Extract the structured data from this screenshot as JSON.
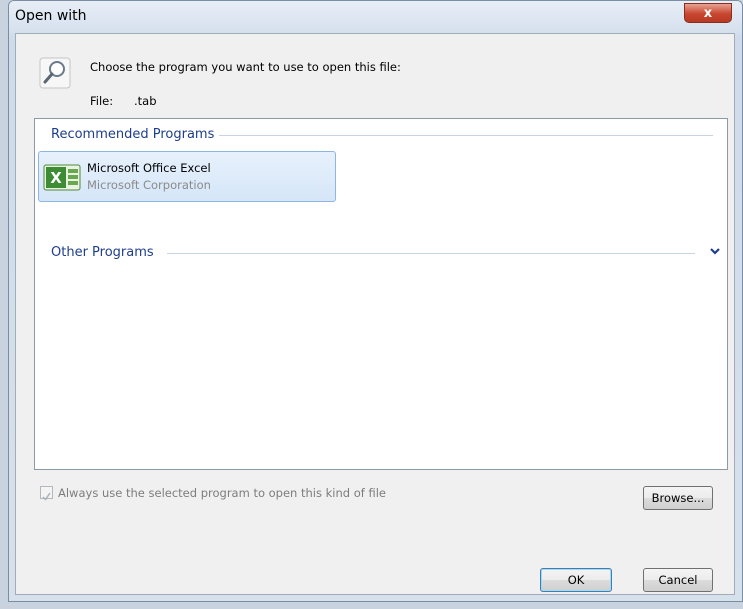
{
  "window": {
    "title": "Open with",
    "close_glyph": "x"
  },
  "header": {
    "prompt": "Choose the program you want to use to open this file:",
    "file_label": "File:",
    "file_name": ".tab",
    "icon": "magnifier-icon"
  },
  "groups": {
    "recommended": "Recommended Programs",
    "other": "Other Programs"
  },
  "programs": [
    {
      "name": "Microsoft Office Excel",
      "company": "Microsoft Corporation",
      "icon": "excel-icon",
      "selected": true
    }
  ],
  "options": {
    "always_use_label": "Always use the selected program to open this kind of file",
    "always_use_checked": true,
    "always_use_enabled": false
  },
  "buttons": {
    "browse": "Browse...",
    "ok": "OK",
    "cancel": "Cancel"
  },
  "colors": {
    "group_header": "#1e3e8c",
    "selection_fill": "#dceafb",
    "selection_border": "#8fb6e3",
    "close_button": "#c8462f"
  }
}
